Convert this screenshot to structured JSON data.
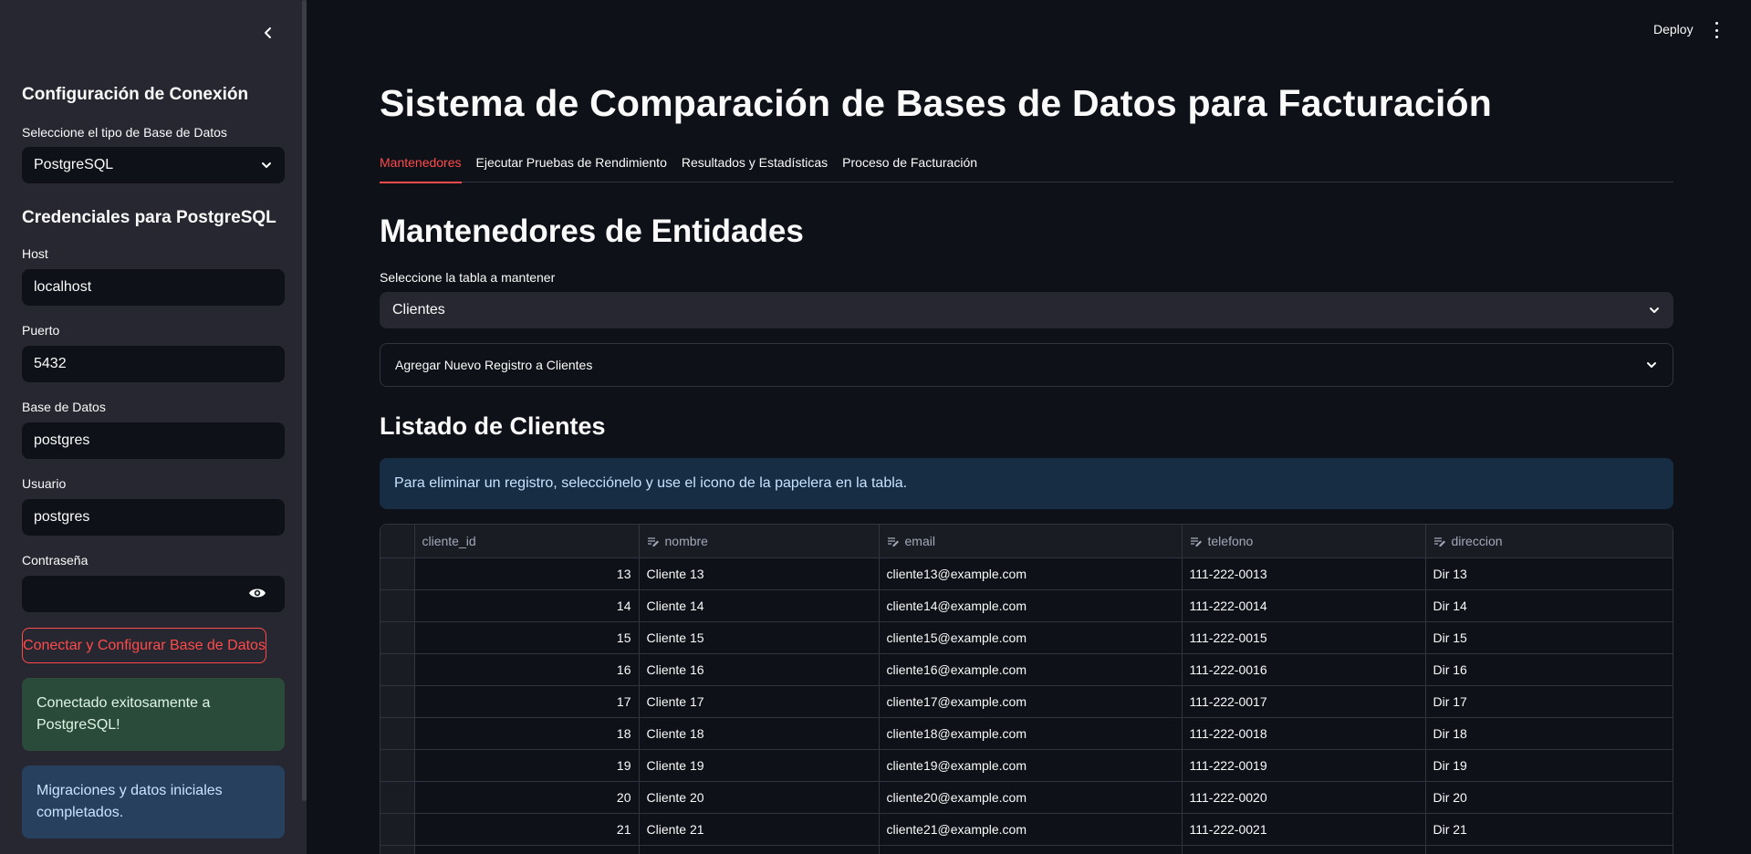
{
  "sidebar": {
    "heading": "Configuración de Conexión",
    "db_type_label": "Seleccione el tipo de Base de Datos",
    "db_type_value": "PostgreSQL",
    "credentials_heading": "Credenciales para PostgreSQL",
    "host_label": "Host",
    "host_value": "localhost",
    "port_label": "Puerto",
    "port_value": "5432",
    "database_label": "Base de Datos",
    "database_value": "postgres",
    "user_label": "Usuario",
    "user_value": "postgres",
    "password_label": "Contraseña",
    "password_value": "",
    "connect_button": "Conectar y Configurar Base de Datos",
    "success_message": "Conectado exitosamente a PostgreSQL!",
    "info_message": "Migraciones y datos iniciales completados."
  },
  "header": {
    "deploy_label": "Deploy"
  },
  "main": {
    "title": "Sistema de Comparación de Bases de Datos para Facturación",
    "tabs": [
      {
        "label": "Mantenedores",
        "active": true
      },
      {
        "label": "Ejecutar Pruebas de Rendimiento",
        "active": false
      },
      {
        "label": "Resultados y Estadísticas",
        "active": false
      },
      {
        "label": "Proceso de Facturación",
        "active": false
      }
    ],
    "section_title": "Mantenedores de Entidades",
    "table_select_label": "Seleccione la tabla a mantener",
    "table_select_value": "Clientes",
    "expander_label": "Agregar Nuevo Registro a Clientes",
    "list_title": "Listado de Clientes",
    "info_text": "Para eliminar un registro, selecciónelo y use el icono de la papelera en la tabla."
  },
  "table": {
    "columns": [
      "cliente_id",
      "nombre",
      "email",
      "telefono",
      "direccion"
    ],
    "rows": [
      [
        "13",
        "Cliente 13",
        "cliente13@example.com",
        "111-222-0013",
        "Dir 13"
      ],
      [
        "14",
        "Cliente 14",
        "cliente14@example.com",
        "111-222-0014",
        "Dir 14"
      ],
      [
        "15",
        "Cliente 15",
        "cliente15@example.com",
        "111-222-0015",
        "Dir 15"
      ],
      [
        "16",
        "Cliente 16",
        "cliente16@example.com",
        "111-222-0016",
        "Dir 16"
      ],
      [
        "17",
        "Cliente 17",
        "cliente17@example.com",
        "111-222-0017",
        "Dir 17"
      ],
      [
        "18",
        "Cliente 18",
        "cliente18@example.com",
        "111-222-0018",
        "Dir 18"
      ],
      [
        "19",
        "Cliente 19",
        "cliente19@example.com",
        "111-222-0019",
        "Dir 19"
      ],
      [
        "20",
        "Cliente 20",
        "cliente20@example.com",
        "111-222-0020",
        "Dir 20"
      ],
      [
        "21",
        "Cliente 21",
        "cliente21@example.com",
        "111-222-0021",
        "Dir 21"
      ],
      [
        "",
        "",
        "",
        "",
        ""
      ]
    ]
  },
  "colors": {
    "accent": "#ff4b4b",
    "sidebar_bg": "#262730",
    "main_bg": "#0e1117",
    "success_bg": "#2b4b3a",
    "info_bg": "#27405e"
  }
}
